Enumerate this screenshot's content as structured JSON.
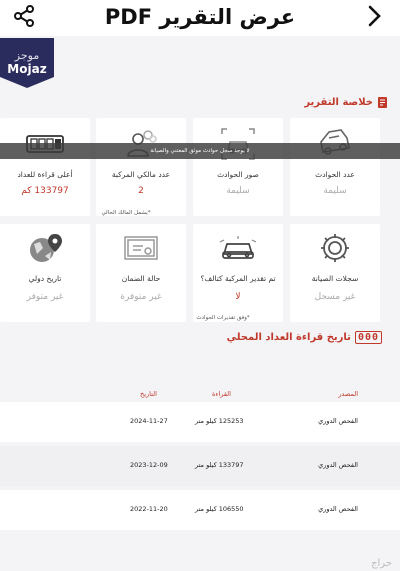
{
  "header": {
    "title": "عرض التقرير PDF"
  },
  "logo": {
    "arabic": "موجز",
    "english": "Mojaz"
  },
  "summary": {
    "title": "خلاصة التقرير"
  },
  "toast": "لا يوجد سجل حوادث موثق المعتني والصيانة",
  "cards_row1": [
    {
      "label": "عدد الحوادث",
      "value": "سليمة"
    },
    {
      "label": "صور الحوادث",
      "value": "سليمة"
    },
    {
      "label": "عدد مالكي المركبة",
      "value": "2",
      "note": "*يشمل المالك الحالي"
    },
    {
      "label": "أعلى قراءة للعداد",
      "value": "133797 كم"
    }
  ],
  "cards_row2": [
    {
      "label": "سجلات الصيانة",
      "value": "غير مسجل"
    },
    {
      "label": "تم تقدير المركبة كتالف؟",
      "value": "لا",
      "note": "*وفق تقديرات الحوادث"
    },
    {
      "label": "حالة الضمان",
      "value": "غير متوفرة"
    },
    {
      "label": "تاريخ دولي",
      "value": "غير متوفر"
    }
  ],
  "odometer": {
    "title": "تاريخ قراءة العداد المحلي",
    "digits": "000"
  },
  "table": {
    "headers": {
      "source": "المصدر",
      "reading": "القراءة",
      "date": "التاريخ"
    },
    "rows": [
      {
        "source": "الفحص الدوري",
        "reading": "125253 كيلو متر",
        "date": "2024-11-27"
      },
      {
        "source": "الفحص الدوري",
        "reading": "133797 كيلو متر",
        "date": "2023-12-09"
      },
      {
        "source": "الفحص الدوري",
        "reading": "106550 كيلو متر",
        "date": "2022-11-20"
      }
    ]
  },
  "watermark": "حراج",
  "colors": {
    "accent": "#c0392b",
    "logo_bg": "#2b2c5e"
  }
}
